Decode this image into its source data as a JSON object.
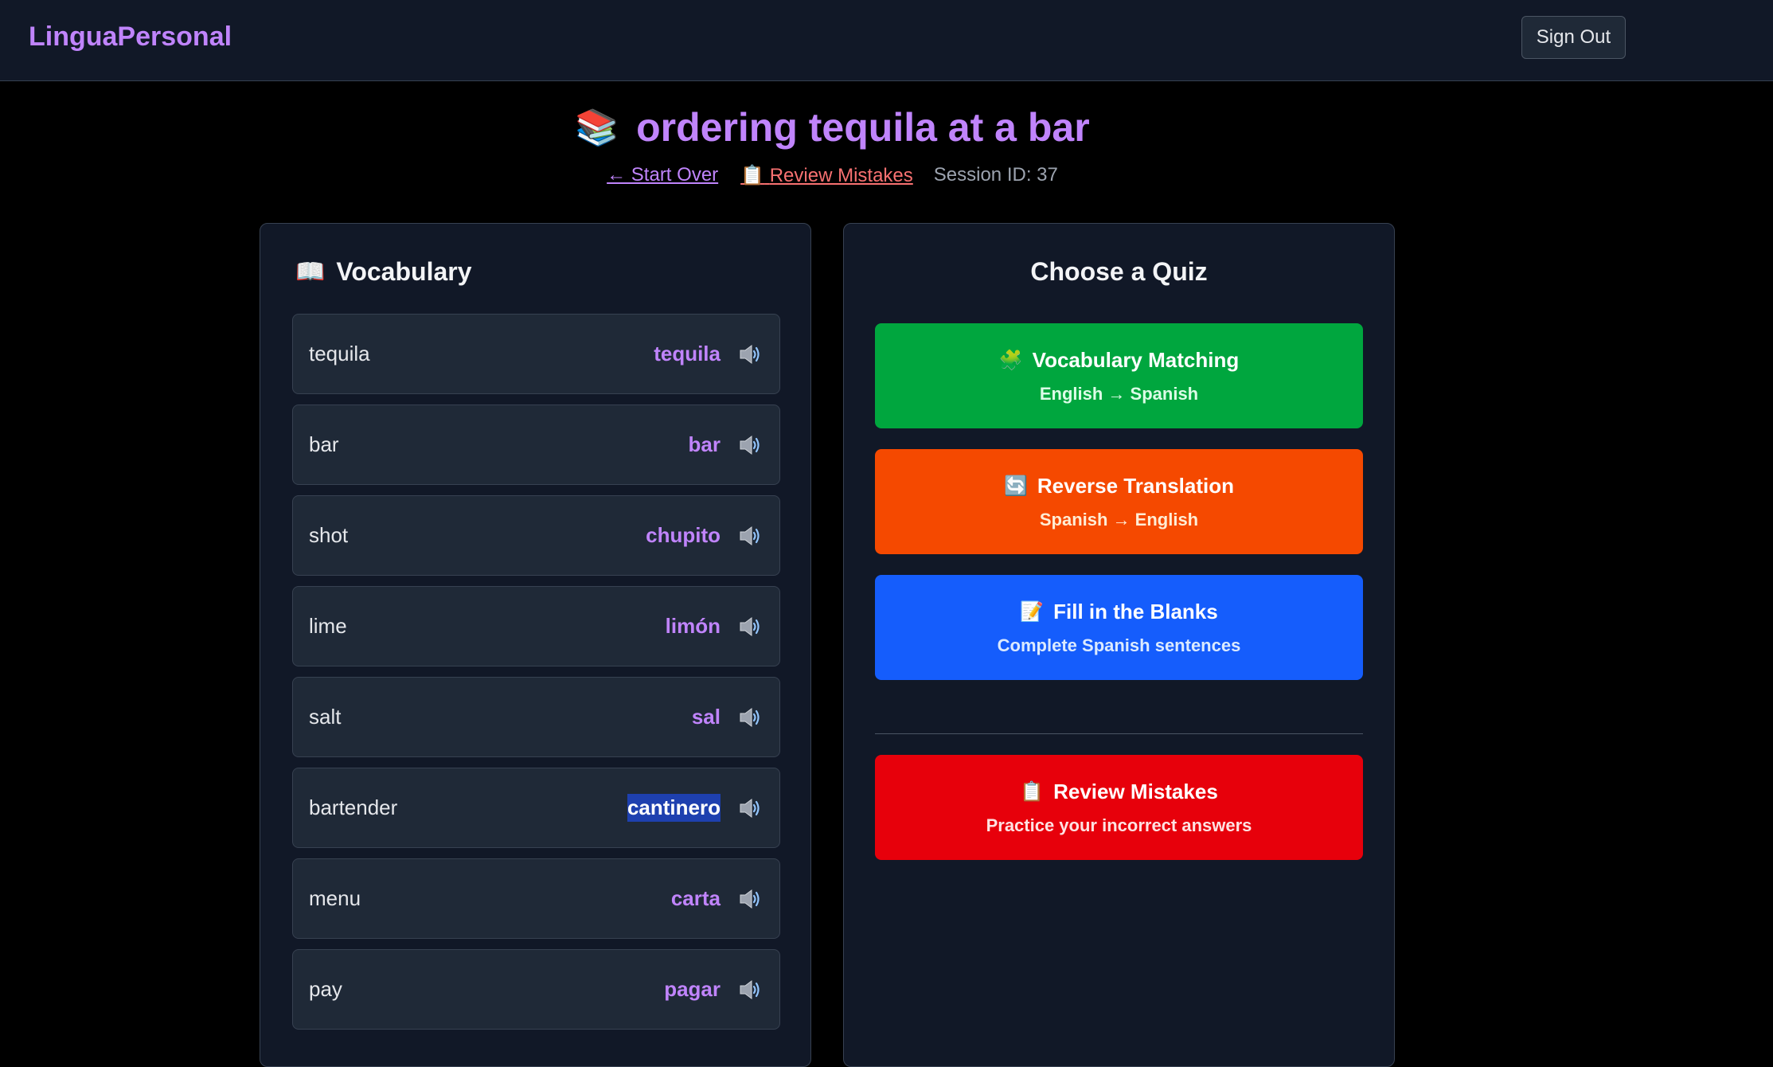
{
  "header": {
    "brand": "LinguaPersonal",
    "sign_out_label": "Sign Out"
  },
  "page": {
    "title_icon": "📚",
    "title": "ordering tequila at a bar",
    "start_over_label": "← Start Over",
    "review_link_icon": "📋",
    "review_link_label": "Review Mistakes",
    "session_label": "Session ID: 37"
  },
  "vocabulary": {
    "icon": "📖",
    "heading": "Vocabulary",
    "items": [
      {
        "en": "tequila",
        "es": "tequila"
      },
      {
        "en": "bar",
        "es": "bar"
      },
      {
        "en": "shot",
        "es": "chupito"
      },
      {
        "en": "lime",
        "es": "limón"
      },
      {
        "en": "salt",
        "es": "sal"
      },
      {
        "en": "bartender",
        "es": "cantinero"
      },
      {
        "en": "menu",
        "es": "carta"
      },
      {
        "en": "pay",
        "es": "pagar"
      }
    ],
    "selected_index": 5
  },
  "quiz": {
    "heading": "Choose a Quiz",
    "options": [
      {
        "icon": "🧩",
        "title": "Vocabulary Matching",
        "subtitle": "English → Spanish",
        "color": "#00a63e"
      },
      {
        "icon": "🔄",
        "title": "Reverse Translation",
        "subtitle": "Spanish → English",
        "color": "#f54900"
      },
      {
        "icon": "📝",
        "title": "Fill in the Blanks",
        "subtitle": "Complete Spanish sentences",
        "color": "#155dfc"
      }
    ],
    "review": {
      "icon": "📋",
      "title": "Review Mistakes",
      "subtitle": "Practice your incorrect answers",
      "color": "#e7000b"
    }
  }
}
